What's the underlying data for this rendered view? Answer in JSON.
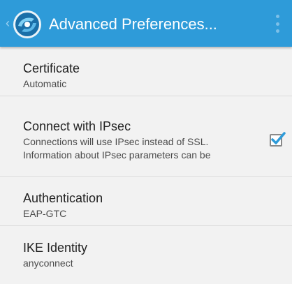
{
  "appbar": {
    "title": "Advanced Preferences...",
    "back_icon": "chevron-left-icon",
    "logo_icon": "anyconnect-logo",
    "overflow_icon": "more-vert-icon",
    "color": "#2e9bd9"
  },
  "preferences": [
    {
      "title": "Certificate",
      "summary": "Automatic"
    },
    {
      "title": "Connect with IPsec",
      "summary_line1": "Connections will use IPsec instead of SSL.",
      "summary_line2": "Information about IPsec parameters can be",
      "checked": true,
      "check_color": "#2e9bd9"
    },
    {
      "title": "Authentication",
      "summary": "EAP-GTC"
    },
    {
      "title": "IKE Identity",
      "summary": "anyconnect"
    }
  ]
}
